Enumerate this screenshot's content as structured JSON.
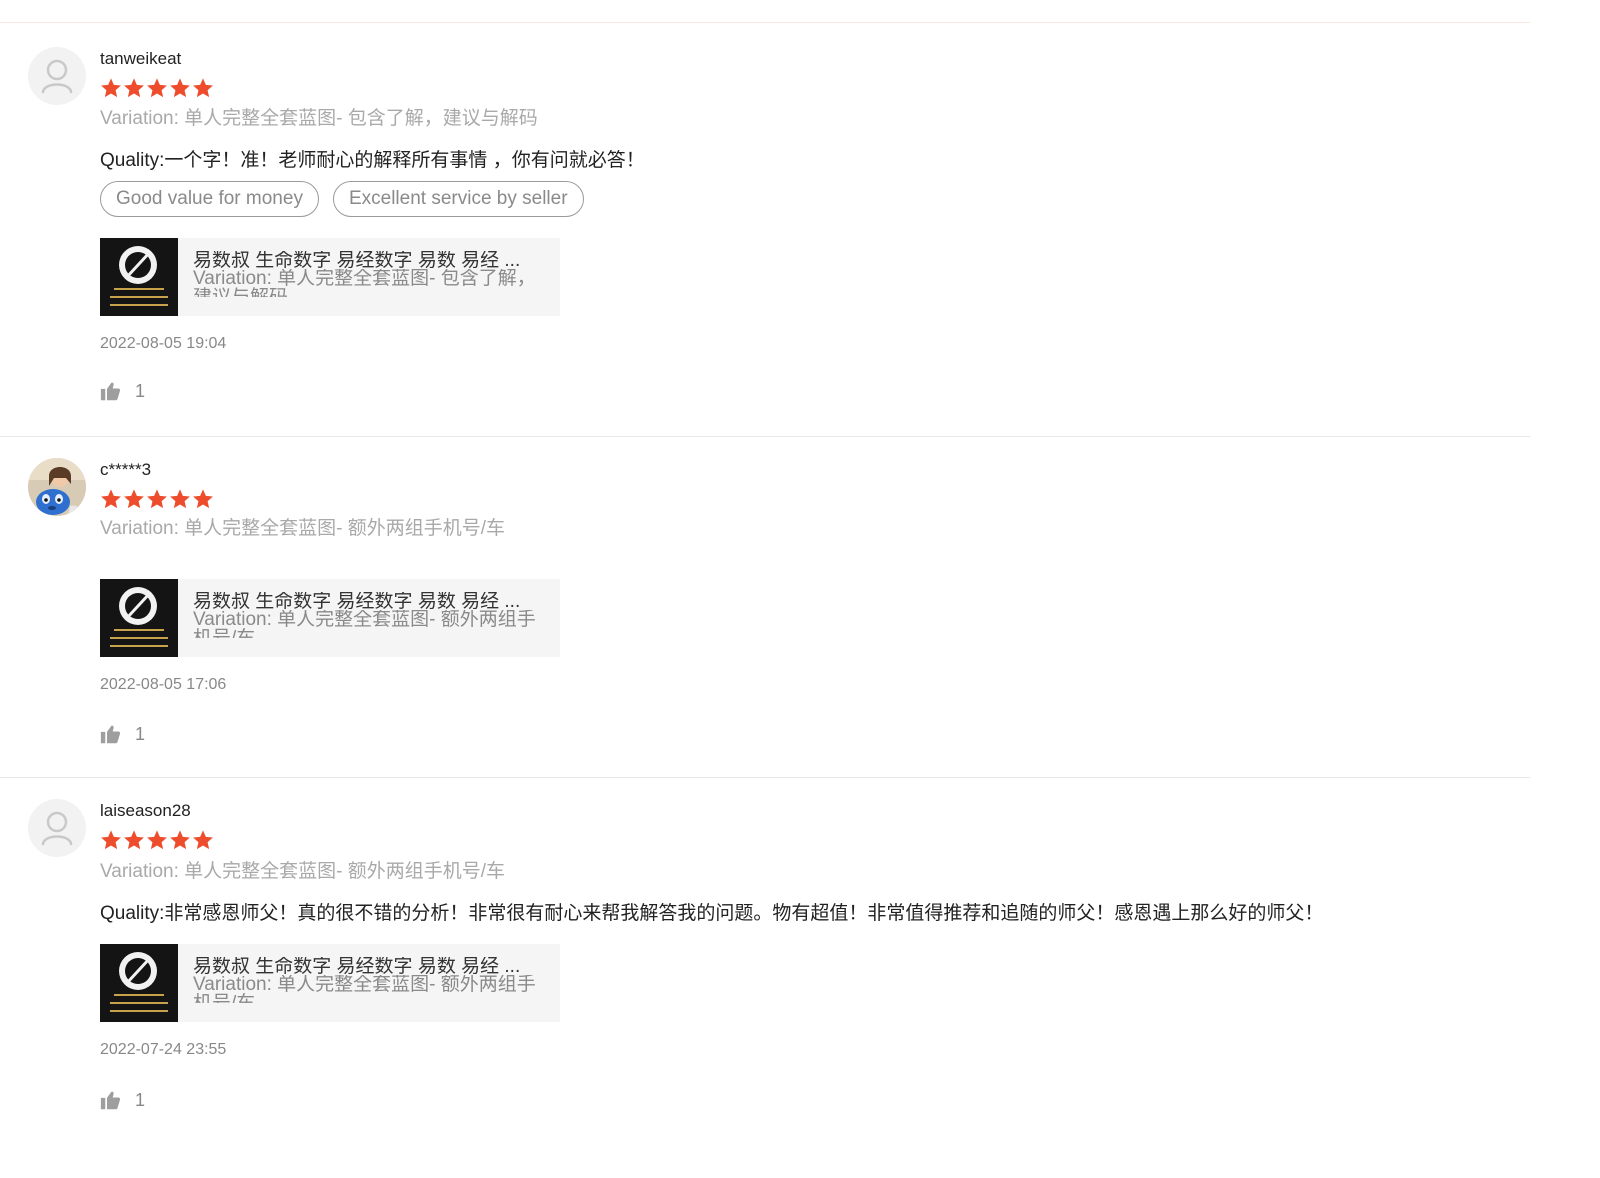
{
  "theme": {
    "star_color": "#ee4d2d",
    "muted_text": "#a9a9a9",
    "icon_gray": "#9e9e9e"
  },
  "reviews": [
    {
      "username": "tanweikeat",
      "rating": 5,
      "avatar": "default-user-icon",
      "variation": "Variation: 单人完整全套蓝图- 包含了解，建议与解码",
      "comment": "Quality:一个字！准！老师耐心的解释所有事情 ，你有问就必答！",
      "tags": [
        "Good value for money",
        "Excellent service by seller"
      ],
      "product": {
        "name": "易数叔 生命数字 易经数字 易数 易经 ...",
        "variation": "Variation: 单人完整全套蓝图- 包含了解，建议与解码"
      },
      "date": "2022-08-05 19:04",
      "likes": "1"
    },
    {
      "username": "c*****3",
      "rating": 5,
      "avatar": "user-photo",
      "variation": "Variation: 单人完整全套蓝图- 额外两组手机号/车",
      "comment": "",
      "tags": [],
      "product": {
        "name": "易数叔 生命数字 易经数字 易数 易经 ...",
        "variation": "Variation: 单人完整全套蓝图- 额外两组手机号/车"
      },
      "date": "2022-08-05 17:06",
      "likes": "1"
    },
    {
      "username": "laiseason28",
      "rating": 5,
      "avatar": "default-user-icon",
      "variation": "Variation: 单人完整全套蓝图- 额外两组手机号/车",
      "comment": "Quality:非常感恩师父！真的很不错的分析！非常很有耐心来帮我解答我的问题。物有超值！非常值得推荐和追随的师父！感恩遇上那么好的师父！",
      "tags": [],
      "product": {
        "name": "易数叔 生命数字 易经数字 易数 易经 ...",
        "variation": "Variation: 单人完整全套蓝图- 额外两组手机号/车"
      },
      "date": "2022-07-24 23:55",
      "likes": "1"
    }
  ]
}
